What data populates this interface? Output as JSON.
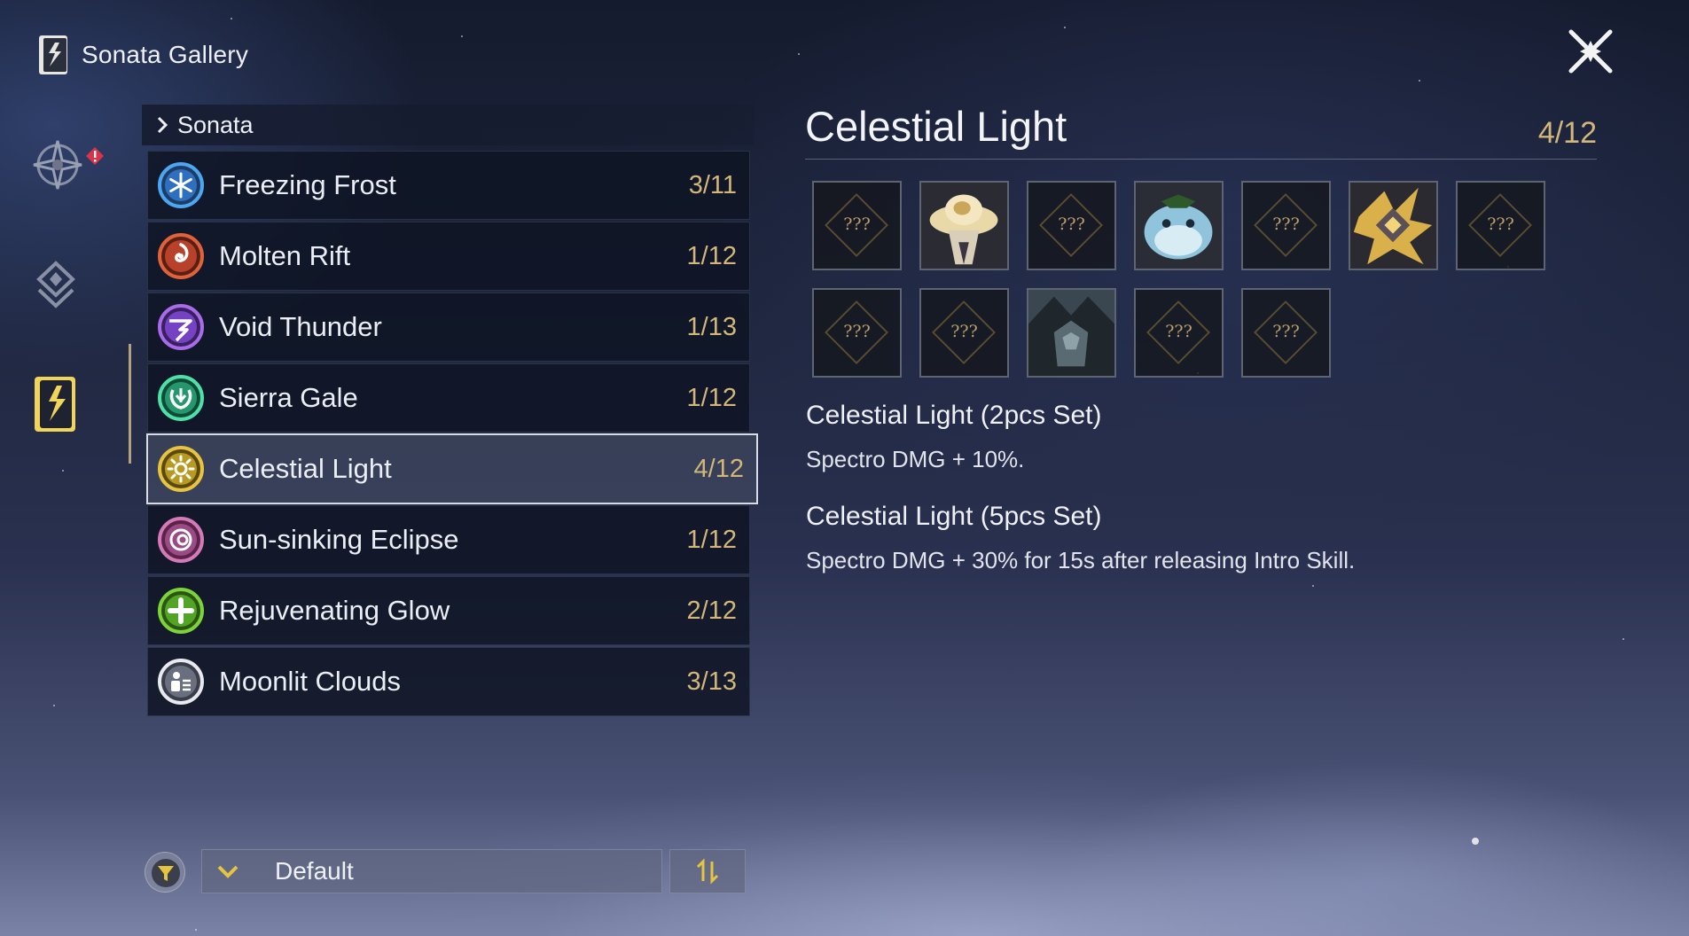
{
  "header": {
    "title": "Sonata Gallery"
  },
  "list": {
    "section_label": "Sonata",
    "items": [
      {
        "name": "Freezing Frost",
        "count": "3/11",
        "icon": "snowflake-icon",
        "color": "#4da6f0"
      },
      {
        "name": "Molten Rift",
        "count": "1/12",
        "icon": "flame-swirl-icon",
        "color": "#e0623a"
      },
      {
        "name": "Void Thunder",
        "count": "1/13",
        "icon": "thunder-swirl-icon",
        "color": "#a86ce8"
      },
      {
        "name": "Sierra Gale",
        "count": "1/12",
        "icon": "wind-icon",
        "color": "#4fe0a8"
      },
      {
        "name": "Celestial Light",
        "count": "4/12",
        "icon": "sun-icon",
        "color": "#e6c441",
        "active": true
      },
      {
        "name": "Sun-sinking Eclipse",
        "count": "1/12",
        "icon": "eclipse-icon",
        "color": "#d47ab8"
      },
      {
        "name": "Rejuvenating Glow",
        "count": "2/12",
        "icon": "heal-plus-icon",
        "color": "#7cd43a"
      },
      {
        "name": "Moonlit Clouds",
        "count": "3/13",
        "icon": "cloud-icon",
        "color": "#e8eaf0"
      }
    ]
  },
  "sort": {
    "label": "Default"
  },
  "detail": {
    "title": "Celestial Light",
    "count": "4/12",
    "echoes": [
      {
        "state": "locked",
        "label": "???"
      },
      {
        "state": "unlocked",
        "icon": "golden-hat-echo-icon"
      },
      {
        "state": "locked",
        "label": "???"
      },
      {
        "state": "unlocked",
        "icon": "blue-blob-echo-icon"
      },
      {
        "state": "locked",
        "label": "???"
      },
      {
        "state": "unlocked",
        "icon": "golden-crystal-echo-icon"
      },
      {
        "state": "locked",
        "label": "???"
      },
      {
        "state": "locked",
        "label": "???"
      },
      {
        "state": "locked",
        "label": "???"
      },
      {
        "state": "unlocked",
        "icon": "dark-armored-echo-icon"
      },
      {
        "state": "locked",
        "label": "???"
      },
      {
        "state": "locked",
        "label": "???"
      }
    ],
    "set2": {
      "title": "Celestial Light (2pcs Set)",
      "desc": "Spectro DMG + 10%."
    },
    "set5": {
      "title": "Celestial Light (5pcs Set)",
      "desc": "Spectro DMG + 30% for 15s after releasing Intro Skill."
    }
  },
  "colors": {
    "accent_gold": "#d2b67a",
    "active_border": "#d9dbe2"
  }
}
